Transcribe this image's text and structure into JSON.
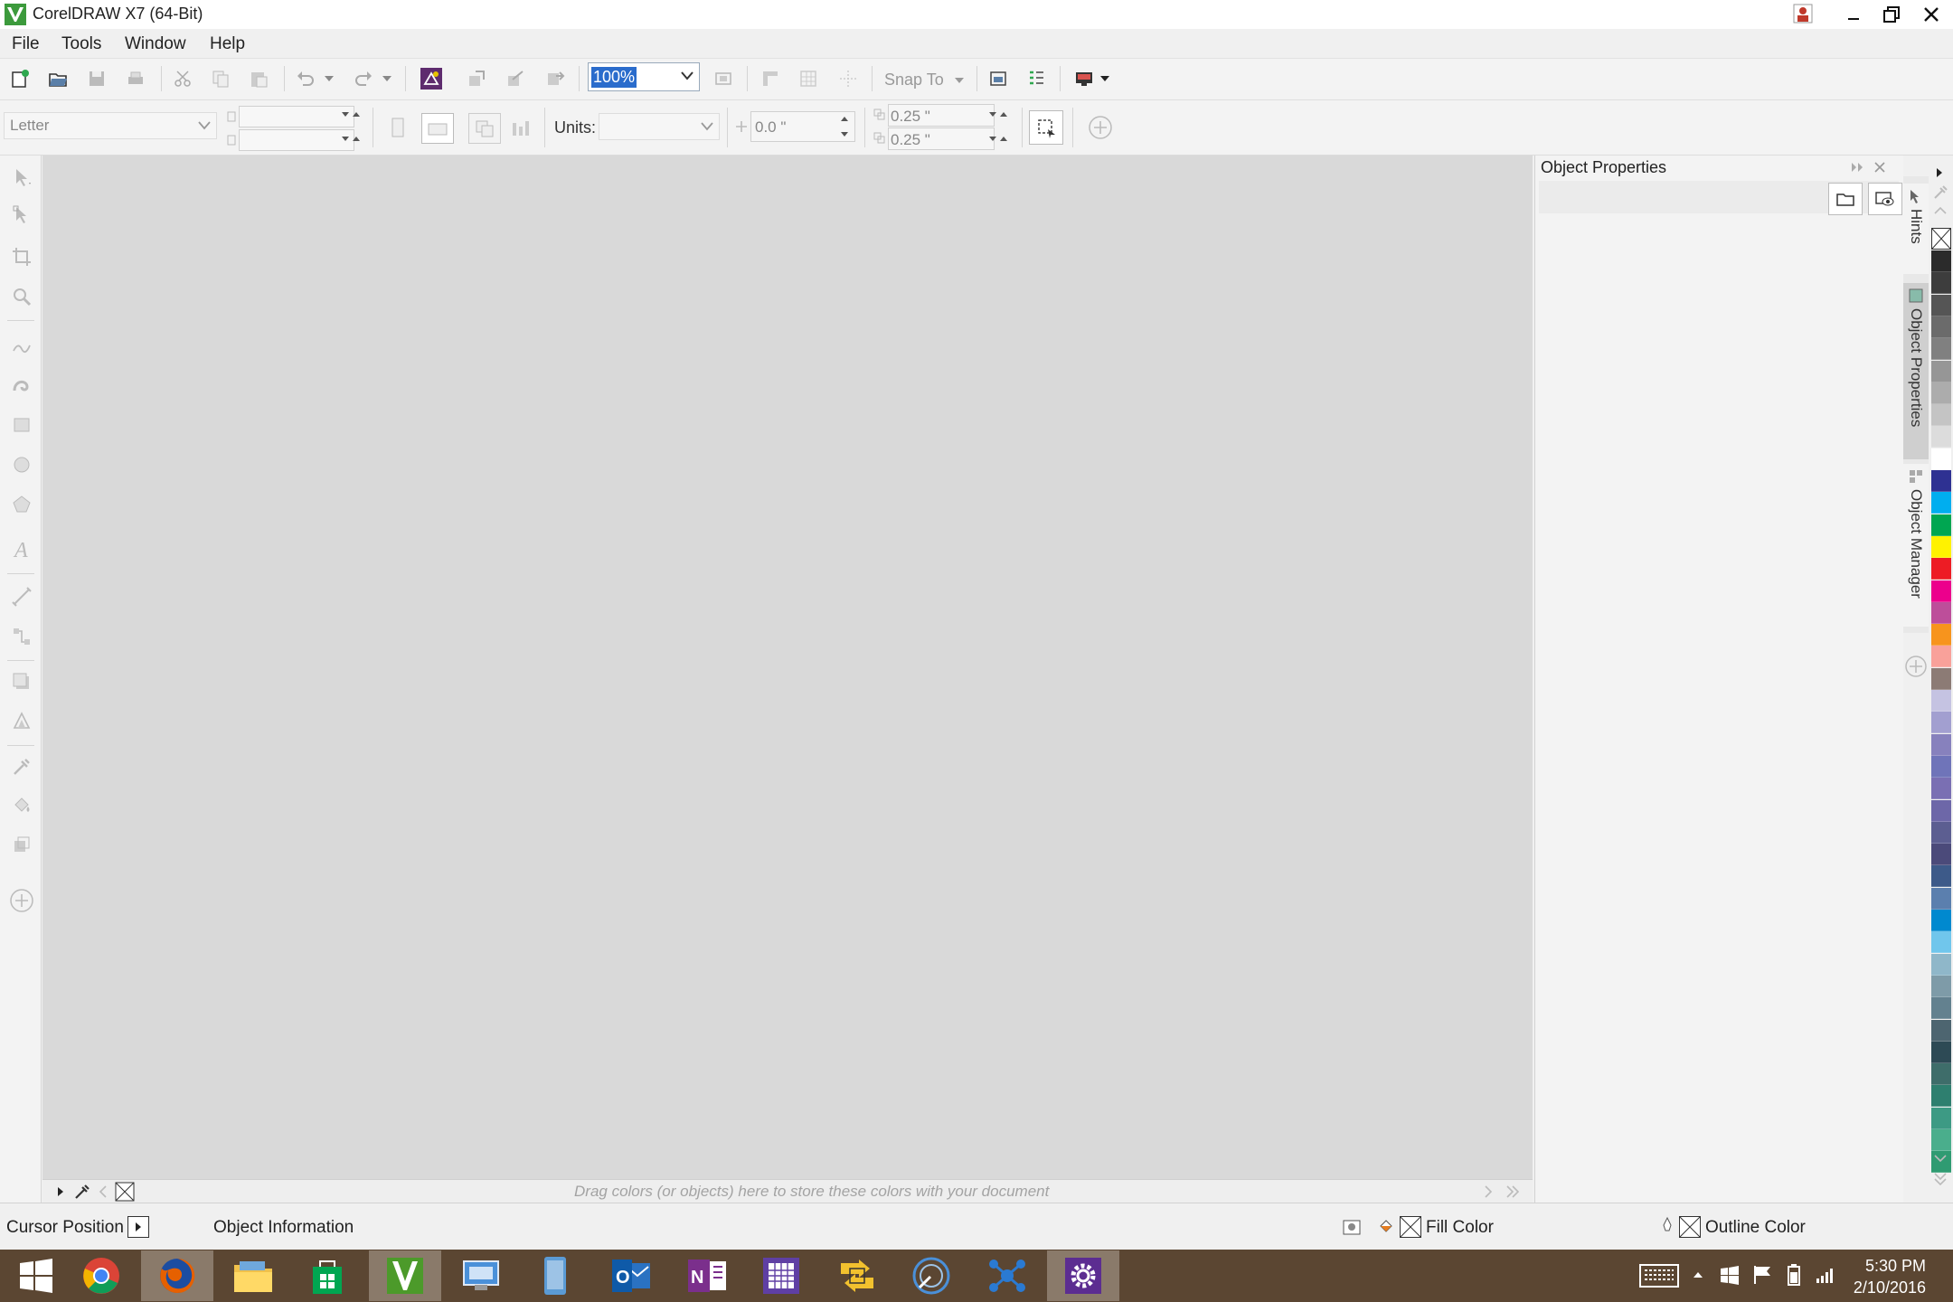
{
  "window": {
    "title": "CorelDRAW X7 (64-Bit)"
  },
  "menu": [
    "File",
    "Tools",
    "Window",
    "Help"
  ],
  "standard_toolbar": {
    "zoom_value": "100%",
    "snap_to_label": "Snap To"
  },
  "property_bar": {
    "page_size": "Letter",
    "units_label": "Units:",
    "nudge_value": "0.0 \"",
    "dup_x": "0.25 \"",
    "dup_y": "0.25 \""
  },
  "docker": {
    "title": "Object Properties",
    "tabs": [
      "Hints",
      "Object Properties",
      "Object Manager"
    ]
  },
  "document_palette": {
    "hint": "Drag colors (or objects) here to store these colors with your document"
  },
  "color_palette": {
    "colors": [
      "#2b2b2b",
      "#3d3d3d",
      "#555555",
      "#6b6b6b",
      "#808080",
      "#969696",
      "#acacac",
      "#c4c4c4",
      "#dcdcdc",
      "#ffffff",
      "#2e3192",
      "#00aeef",
      "#00a651",
      "#fff200",
      "#ed1c24",
      "#ec008c",
      "#bd4e9a",
      "#f7941d",
      "#f9a19a",
      "#8c7b75",
      "#c5c3e2",
      "#a29fd0",
      "#8781bd",
      "#6f74b9",
      "#7a6fb3",
      "#6d67a8",
      "#5c5e91",
      "#4b4a7a",
      "#3d5a89",
      "#5b7fae",
      "#0089cf",
      "#70c6ec",
      "#8fb7c9",
      "#7e9ba8",
      "#63818f",
      "#4d6570",
      "#2d4a55",
      "#3e6d6a",
      "#2e7f6f",
      "#3d9a84",
      "#4aae8c",
      "#2f9b72"
    ]
  },
  "status_bar": {
    "cursor_position": "Cursor Position",
    "object_information": "Object Information",
    "fill_color": "Fill Color",
    "outline_color": "Outline Color"
  },
  "taskbar": {
    "apps": [
      "start",
      "chrome",
      "firefox",
      "file-explorer",
      "store",
      "coreldraw",
      "remote-desktop",
      "tablet-app",
      "outlook",
      "onenote",
      "calendar-app",
      "transfer-app",
      "connect-app",
      "network-app",
      "settings"
    ],
    "time": "5:30 PM",
    "date": "2/10/2016"
  }
}
